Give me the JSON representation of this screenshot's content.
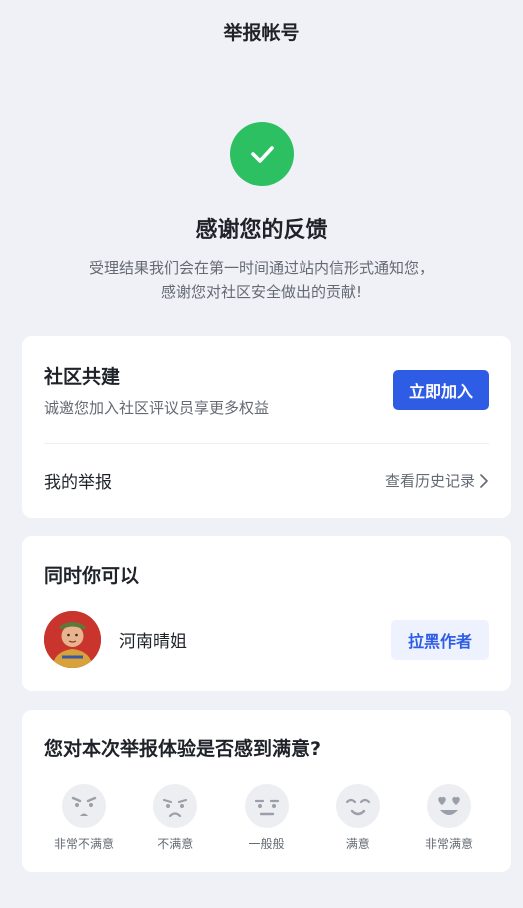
{
  "header": {
    "title": "举报帐号"
  },
  "success": {
    "icon": "check-icon",
    "color": "#2dc062",
    "title": "感谢您的反馈",
    "desc_line1": "受理结果我们会在第一时间通过站内信形式通知您，",
    "desc_line2": "感谢您对社区安全做出的贡献!"
  },
  "community": {
    "title": "社区共建",
    "subtitle": "诚邀您加入社区评议员享更多权益",
    "join_label": "立即加入",
    "my_report_label": "我的举报",
    "history_label": "查看历史记录"
  },
  "also": {
    "title": "同时你可以",
    "user_name": "河南晴姐",
    "block_label": "拉黑作者"
  },
  "survey": {
    "title": "您对本次举报体验是否感到满意?",
    "options": [
      {
        "label": "非常不满意",
        "icon": "very-unsatisfied-face-icon"
      },
      {
        "label": "不满意",
        "icon": "unsatisfied-face-icon"
      },
      {
        "label": "一般般",
        "icon": "neutral-face-icon"
      },
      {
        "label": "满意",
        "icon": "satisfied-face-icon"
      },
      {
        "label": "非常满意",
        "icon": "very-satisfied-face-icon"
      }
    ]
  },
  "colors": {
    "accent": "#2f5ce4",
    "success": "#2dc062",
    "background": "#f0f1f6"
  }
}
